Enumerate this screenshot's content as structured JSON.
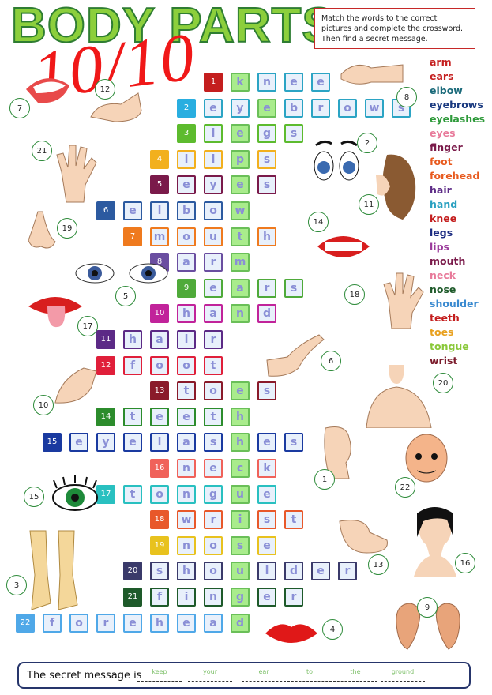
{
  "title": "BODY PARTS",
  "score": "10/10",
  "instructions": "Match the words to the correct pictures and complete the crossword. Then find a secret message.",
  "crossword": [
    {
      "num": "1",
      "word": "KNEE",
      "start": 8,
      "key": 0,
      "numColor": "#c41e1e",
      "border": "#2ba4c4"
    },
    {
      "num": "2",
      "word": "EYEBROWS",
      "start": 7,
      "key": 2,
      "numColor": "#29aee0",
      "border": "#2ba4c4"
    },
    {
      "num": "3",
      "word": "LEGS",
      "start": 7,
      "key": 1,
      "numColor": "#5dbb2e",
      "border": "#5dbb2e"
    },
    {
      "num": "4",
      "word": "LIPS",
      "start": 6,
      "key": 2,
      "numColor": "#f2b01e",
      "border": "#f2b01e"
    },
    {
      "num": "5",
      "word": "EYES",
      "start": 6,
      "key": 2,
      "numColor": "#7a1a4a",
      "border": "#7a1a4a"
    },
    {
      "num": "6",
      "word": "ELBOW",
      "start": 4,
      "key": 4,
      "numColor": "#2c5aa0",
      "border": "#2c5aa0"
    },
    {
      "num": "7",
      "word": "MOUTH",
      "start": 5,
      "key": 3,
      "numColor": "#ef7a1e",
      "border": "#ef7a1e"
    },
    {
      "num": "8",
      "word": "ARM",
      "start": 6,
      "key": 2,
      "numColor": "#6a4ea0",
      "border": "#6a4ea0"
    },
    {
      "num": "9",
      "word": "EARS",
      "start": 7,
      "key": 1,
      "numColor": "#4faa3a",
      "border": "#4faa3a"
    },
    {
      "num": "10",
      "word": "HAND",
      "start": 6,
      "key": 2,
      "numColor": "#c1239a",
      "border": "#c1239a"
    },
    {
      "num": "11",
      "word": "HAIR",
      "start": 4,
      "key": 4,
      "numColor": "#5c2a86",
      "border": "#5c2a86"
    },
    {
      "num": "12",
      "word": "FOOT",
      "start": 4,
      "key": 4,
      "numColor": "#e01f3a",
      "border": "#e01f3a"
    },
    {
      "num": "13",
      "word": "TOES",
      "start": 6,
      "key": 2,
      "numColor": "#8a1a2a",
      "border": "#8a1a2a"
    },
    {
      "num": "14",
      "word": "TEETH",
      "start": 4,
      "key": 4,
      "numColor": "#2c8c2c",
      "border": "#2c8c2c"
    },
    {
      "num": "15",
      "word": "EYELASHES",
      "start": 2,
      "key": 6,
      "numColor": "#1a3aa0",
      "border": "#1a3aa0"
    },
    {
      "num": "16",
      "word": "NECK",
      "start": 6,
      "key": 2,
      "numColor": "#f0625a",
      "border": "#f0625a"
    },
    {
      "num": "17",
      "word": "TONGUE",
      "start": 4,
      "key": 4,
      "numColor": "#29c0c0",
      "border": "#29c0c0"
    },
    {
      "num": "18",
      "word": "WRIST",
      "start": 6,
      "key": 2,
      "numColor": "#e8582a",
      "border": "#e8582a"
    },
    {
      "num": "19",
      "word": "NOSE",
      "start": 6,
      "key": 2,
      "numColor": "#e8c21e",
      "border": "#e8c21e"
    },
    {
      "num": "20",
      "word": "SHOULDER",
      "start": 5,
      "key": 3,
      "numColor": "#3a3a6a",
      "border": "#3a3a6a"
    },
    {
      "num": "21",
      "word": "FINGER",
      "start": 5,
      "key": 3,
      "numColor": "#1e5a2a",
      "border": "#1e5a2a"
    },
    {
      "num": "22",
      "word": "FOREHEAD",
      "start": 1,
      "key": 7,
      "numColor": "#4fa8e8",
      "border": "#4fa8e8"
    }
  ],
  "word_list": [
    {
      "w": "arm",
      "c": "#c41e1e"
    },
    {
      "w": "ears",
      "c": "#c41e1e"
    },
    {
      "w": "elbow",
      "c": "#1a6a7a"
    },
    {
      "w": "eyebrows",
      "c": "#1a3a80"
    },
    {
      "w": "eyelashes",
      "c": "#2e9a3a"
    },
    {
      "w": "eyes",
      "c": "#e87a9a"
    },
    {
      "w": "finger",
      "c": "#7a1a4a"
    },
    {
      "w": "foot",
      "c": "#e85a1e"
    },
    {
      "w": "forehead",
      "c": "#e85a1e"
    },
    {
      "w": "hair",
      "c": "#5c2a86"
    },
    {
      "w": "hand",
      "c": "#29a0c0"
    },
    {
      "w": "knee",
      "c": "#c41e1e"
    },
    {
      "w": "legs",
      "c": "#1a2a80"
    },
    {
      "w": "lips",
      "c": "#9a3a9a"
    },
    {
      "w": "mouth",
      "c": "#7a1a4a"
    },
    {
      "w": "neck",
      "c": "#e87a9a"
    },
    {
      "w": "nose",
      "c": "#1e5a2a"
    },
    {
      "w": "shoulder",
      "c": "#3a8ad0"
    },
    {
      "w": "teeth",
      "c": "#c41e1e"
    },
    {
      "w": "toes",
      "c": "#e8a01e"
    },
    {
      "w": "tongue",
      "c": "#8ac83a"
    },
    {
      "w": "wrist",
      "c": "#7a1a2a"
    }
  ],
  "picture_numbers": [
    "7",
    "17",
    "21",
    "19",
    "5",
    "10",
    "15",
    "3",
    "2",
    "8",
    "11",
    "14",
    "18",
    "6",
    "20",
    "1",
    "22",
    "16",
    "13",
    "9",
    "4",
    "12"
  ],
  "secret": {
    "label": "The secret message is",
    "answers": [
      "keep",
      "your",
      "ear",
      "to",
      "the",
      "ground"
    ]
  }
}
